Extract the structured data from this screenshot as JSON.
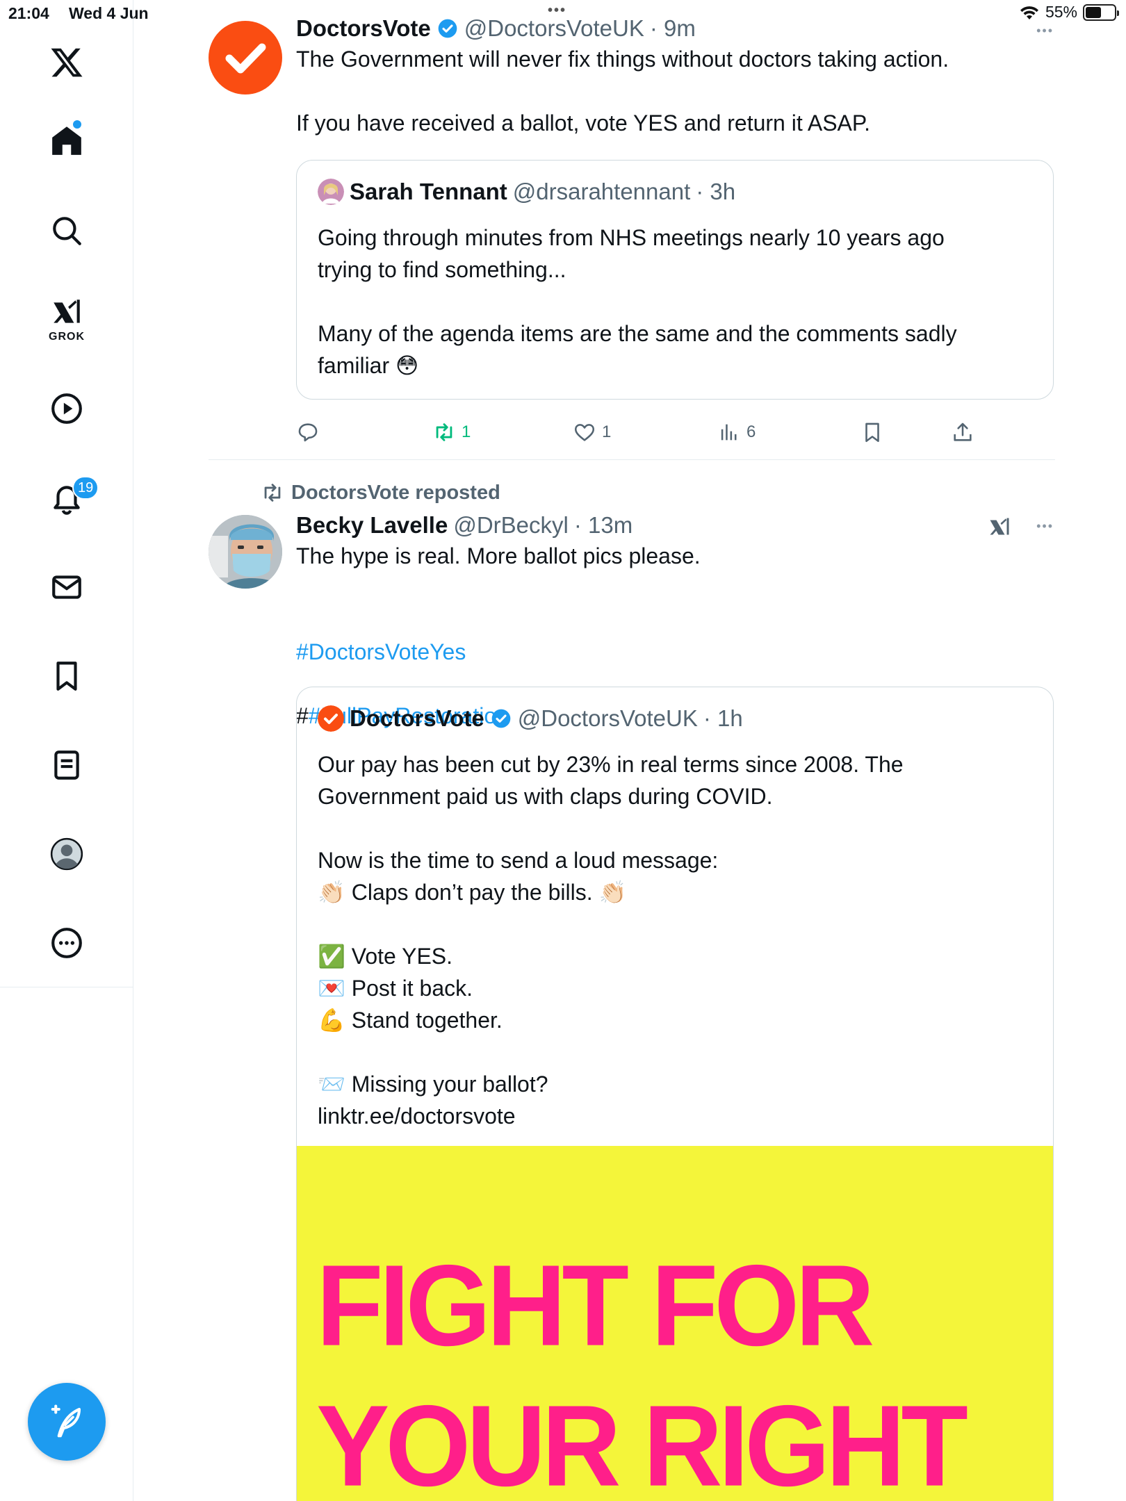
{
  "status_bar": {
    "time": "21:04",
    "date": "Wed 4 Jun",
    "battery": "55%",
    "battery_level": 0.55
  },
  "sidebar": {
    "notifications_count": "19",
    "grok_label": "GROK",
    "items": [
      "x-logo",
      "home",
      "search",
      "grok",
      "video",
      "notifications",
      "messages",
      "bookmarks",
      "lists",
      "profile",
      "more"
    ]
  },
  "tweet1": {
    "name": "DoctorsVote",
    "handle": "@DoctorsVoteUK",
    "time": "· 9m",
    "text": "The Government will never fix things without doctors taking action.\n\nIf you have received a ballot, vote YES and return it ASAP.",
    "quote": {
      "name": "Sarah Tennant",
      "handle": "@drsarahtennant",
      "time": "· 3h",
      "text": "Going through minutes from NHS meetings nearly 10 years ago\ntrying to find something...\n\nMany of the agenda items are the same and the comments sadly\nfamiliar 😳"
    },
    "actions": {
      "replies": "",
      "reposts": "1",
      "likes": "1",
      "views": "6"
    }
  },
  "tweet2": {
    "repost_label": "DoctorsVote reposted",
    "name": "Becky Lavelle",
    "handle": "@DrBeckyl",
    "time": "· 13m",
    "text": "The hype is real. More ballot pics please.",
    "hashtag1": "#DoctorsVoteYes",
    "hashtag2_prefix": "#",
    "hashtag2": "#FullPayRestoration",
    "quote": {
      "name": "DoctorsVote",
      "handle": "@DoctorsVoteUK",
      "time": "· 1h",
      "text": "Our pay has been cut by 23% in real terms since 2008. The\nGovernment paid us with claps during COVID.\n\nNow is the time to send a loud message:\n👏🏻 Claps don’t pay the bills. 👏🏻\n\n✅ Vote YES.\n💌 Post it back.\n💪 Stand together.\n\n📨 Missing your ballot?\nlinktr.ee/doctorsvote",
      "poster_line1": "FIGHT FOR",
      "poster_line2": "YOUR RIGHT"
    }
  },
  "colors": {
    "accent": "#1d9bf0",
    "brand_orange": "#fa4d12",
    "retweet_green": "#00ba7c",
    "poster_yellow": "#f4f53a",
    "poster_pink": "#ff1f8a"
  }
}
